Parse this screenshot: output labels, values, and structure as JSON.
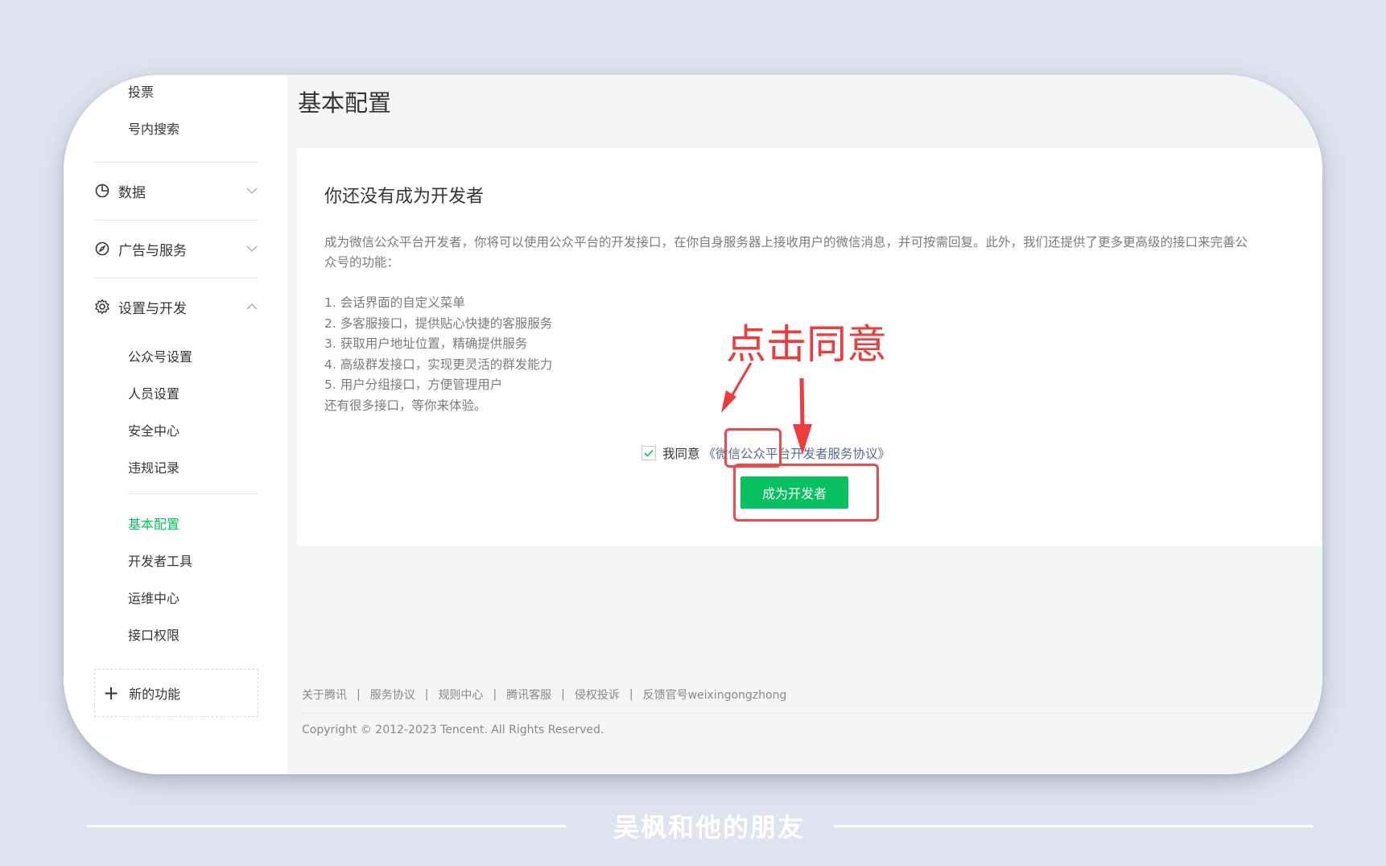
{
  "sidebar": {
    "top_items": [
      "投票",
      "号内搜索"
    ],
    "groups": [
      {
        "label": "数据",
        "icon": "pie-chart-icon",
        "expanded": false
      },
      {
        "label": "广告与服务",
        "icon": "compass-icon",
        "expanded": false
      },
      {
        "label": "设置与开发",
        "icon": "gear-icon",
        "expanded": true
      }
    ],
    "settings_items": [
      "公众号设置",
      "人员设置",
      "安全中心",
      "违规记录"
    ],
    "dev_items": [
      "基本配置",
      "开发者工具",
      "运维中心",
      "接口权限"
    ],
    "active_item": "基本配置",
    "new_feature_label": "新的功能"
  },
  "main": {
    "page_title": "基本配置",
    "panel_title": "你还没有成为开发者",
    "description": "成为微信公众平台开发者，你将可以使用公众平台的开发接口，在你自身服务器上接收用户的微信消息，并可按需回复。此外，我们还提供了更多更高级的接口来完善公众号的功能：",
    "features": [
      "1. 会话界面的自定义菜单",
      "2. 多客服接口，提供贴心快捷的客服服务",
      "3. 获取用户地址位置，精确提供服务",
      "4. 高级群发接口，实现更灵活的群发能力",
      "5. 用户分组接口，方便管理用户",
      "还有很多接口，等你来体验。"
    ],
    "agree_checked": true,
    "agree_text": "我同意",
    "agreement_link": "《微信公众平台开发者服务协议》",
    "become_dev_button": "成为开发者"
  },
  "annotation": {
    "text": "点击同意",
    "color": "#ee3b3b"
  },
  "footer": {
    "links": [
      "关于腾讯",
      "服务协议",
      "规则中心",
      "腾讯客服",
      "侵权投诉",
      "反馈官号weixingongzhong"
    ],
    "copyright": "Copyright © 2012-2023 Tencent. All Rights Reserved."
  },
  "watermark": "吴枫和他的朋友",
  "colors": {
    "accent_green": "#07c160",
    "link_blue": "#576b95",
    "annotation_red": "#e94a4a",
    "background": "#e0e3ef"
  }
}
